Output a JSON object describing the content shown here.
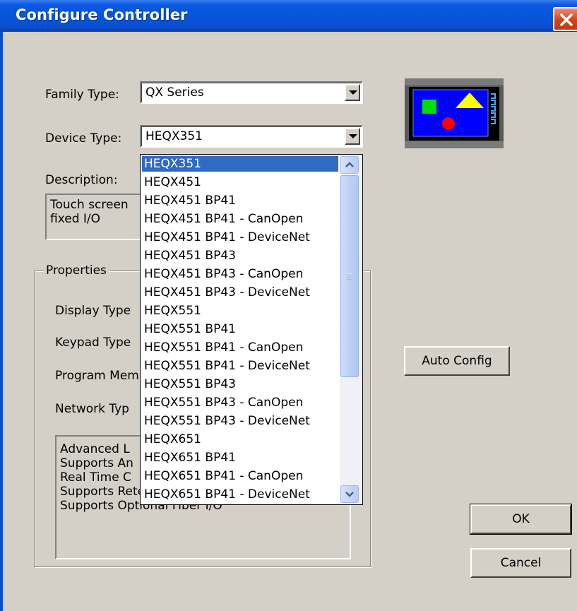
{
  "window": {
    "title": "Configure Controller"
  },
  "family_type": {
    "label": "Family Type:",
    "value": "QX Series"
  },
  "device_type": {
    "label": "Device Type:",
    "value": "HEQX351",
    "options": [
      "HEQX351",
      "HEQX451",
      "HEQX451 BP41",
      "HEQX451 BP41 - CanOpen",
      "HEQX451 BP41 - DeviceNet",
      "HEQX451 BP43",
      "HEQX451 BP43 - CanOpen",
      "HEQX451 BP43 - DeviceNet",
      "HEQX551",
      "HEQX551 BP41",
      "HEQX551 BP41 - CanOpen",
      "HEQX551 BP41 - DeviceNet",
      "HEQX551 BP43",
      "HEQX551 BP43 - CanOpen",
      "HEQX551 BP43 - DeviceNet",
      "HEQX651",
      "HEQX651 BP41",
      "HEQX651 BP41 - CanOpen",
      "HEQX651 BP41 - DeviceNet"
    ],
    "selected_index": 0
  },
  "description": {
    "label": "Description:",
    "line1": "Touch screen",
    "line2": "fixed I/O"
  },
  "properties": {
    "label": "Properties",
    "display_type_label": "Display Type",
    "keypad_type_label": "Keypad Type",
    "program_memory_label": "Program Mem",
    "network_type_label": "Network Typ",
    "features": [
      "Advanced L",
      "Supports An",
      "Real Time C",
      "Supports Retentive Data",
      "Supports Optional Fiber I/O"
    ]
  },
  "buttons": {
    "auto_config": "Auto Config",
    "ok": "OK",
    "cancel": "Cancel"
  },
  "icons": {
    "close": "close-icon",
    "device": "device-icon",
    "dropdown_arrow": "chevron-down-icon",
    "scroll_up": "scroll-up-icon",
    "scroll_down": "scroll-down-icon"
  },
  "colors": {
    "selection": "#316ac5",
    "titlebar": "#0654d8",
    "dialog_bg": "#d4d0c8"
  }
}
